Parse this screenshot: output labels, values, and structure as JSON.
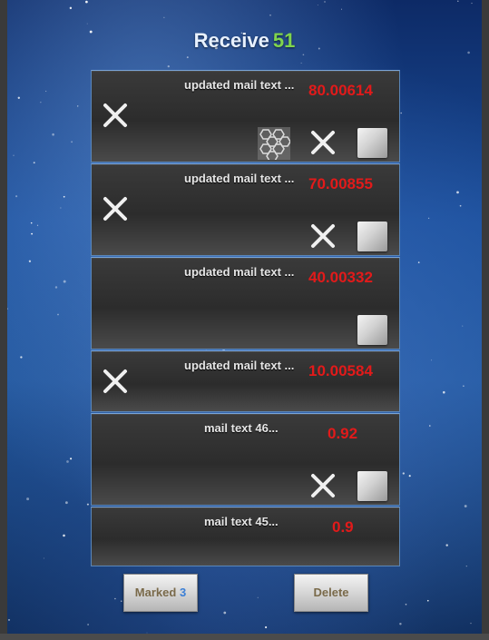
{
  "title": {
    "label": "Receive",
    "count": "51"
  },
  "mails": [
    {
      "subject": "updated mail text ...",
      "value": "80.00614",
      "has_left_delete": true,
      "has_hex": true,
      "has_right_delete": true,
      "has_box": true
    },
    {
      "subject": "updated mail text ...",
      "value": "70.00855",
      "has_left_delete": true,
      "has_hex": false,
      "has_right_delete": true,
      "has_box": true
    },
    {
      "subject": "updated mail text ...",
      "value": "40.00332",
      "has_left_delete": false,
      "has_hex": false,
      "has_right_delete": false,
      "has_box": true
    },
    {
      "subject": "updated mail text ...",
      "value": "10.00584",
      "has_left_delete": true,
      "has_hex": false,
      "has_right_delete": false,
      "has_box": false
    },
    {
      "subject": "mail text 46...",
      "value": "0.92",
      "has_left_delete": false,
      "has_hex": false,
      "has_right_delete": true,
      "has_box": true
    },
    {
      "subject": "mail text 45...",
      "value": "0.9",
      "has_left_delete": false,
      "has_hex": false,
      "has_right_delete": false,
      "has_box": false
    }
  ],
  "buttons": {
    "marked_label": "Marked",
    "marked_count": "3",
    "delete_label": "Delete"
  },
  "colors": {
    "value_red": "#e21a1a",
    "count_green": "#7fd44d",
    "marked_blue": "#3b7fd6"
  },
  "icons": {
    "delete": "x-cross-icon",
    "attachment": "gift-box-icon",
    "item": "hex-grid-icon"
  }
}
